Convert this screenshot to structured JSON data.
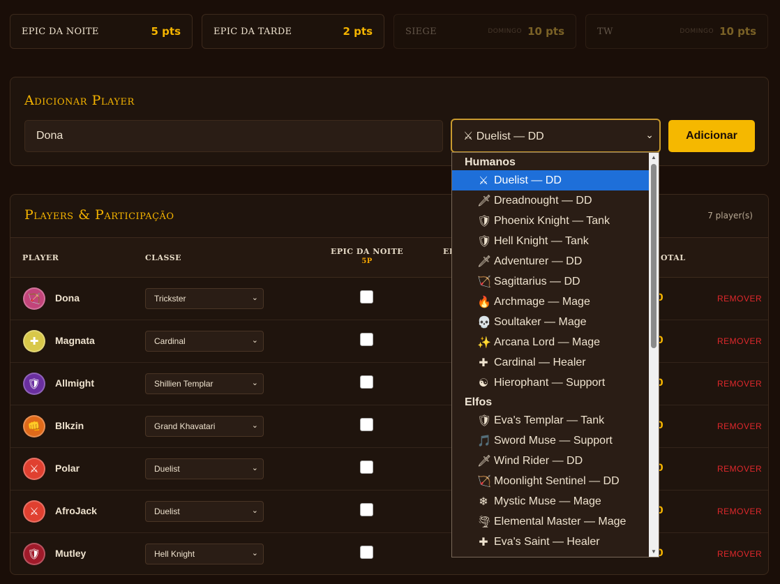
{
  "events": [
    {
      "name": "EPIC DA NOITE",
      "day": "",
      "pts": "5 pts",
      "dim": false
    },
    {
      "name": "EPIC DA TARDE",
      "day": "",
      "pts": "2 pts",
      "dim": false
    },
    {
      "name": "SIEGE",
      "day": "DOMINGO",
      "pts": "10 pts",
      "dim": true
    },
    {
      "name": "TW",
      "day": "DOMINGO",
      "pts": "10 pts",
      "dim": true
    }
  ],
  "add_panel": {
    "title": "Adicionar Player",
    "name_value": "Dona",
    "selected_class": "⚔ Duelist — DD",
    "add_label": "Adicionar"
  },
  "players_panel": {
    "title": "Players & Participação",
    "count": "7 player(s)",
    "headers": {
      "player": "PLAYER",
      "classe": "CLASSE",
      "epic_noite": "EPIC DA NOITE",
      "epic_noite_sub": "5P",
      "epic_tarde": "EF",
      "total": "OTAL"
    }
  },
  "players": [
    {
      "name": "Dona",
      "class": "Trickster",
      "icon": "🏹",
      "color": "#c2447a",
      "total": "0",
      "remove": "REMOVER"
    },
    {
      "name": "Magnata",
      "class": "Cardinal",
      "icon": "✚",
      "color": "#d8c84a",
      "total": "0",
      "remove": "REMOVER"
    },
    {
      "name": "Allmight",
      "class": "Shillien Templar",
      "icon": "🛡",
      "color": "#6a2fa0",
      "total": "0",
      "remove": "REMOVER"
    },
    {
      "name": "Blkzin",
      "class": "Grand Khavatari",
      "icon": "👊",
      "color": "#e06a1a",
      "total": "0",
      "remove": "REMOVER"
    },
    {
      "name": "Polar",
      "class": "Duelist",
      "icon": "⚔",
      "color": "#e04030",
      "total": "0",
      "remove": "REMOVER"
    },
    {
      "name": "AfroJack",
      "class": "Duelist",
      "icon": "⚔",
      "color": "#e04030",
      "total": "0",
      "remove": "REMOVER"
    },
    {
      "name": "Mutley",
      "class": "Hell Knight",
      "icon": "🛡",
      "color": "#a01a2a",
      "total": "0",
      "remove": "REMOVER"
    }
  ],
  "dropdown": {
    "groups": [
      {
        "label": "Humanos",
        "items": [
          {
            "icon": "⚔",
            "label": "Duelist — DD",
            "selected": true
          },
          {
            "icon": "🗡",
            "label": "Dreadnought — DD"
          },
          {
            "icon": "🛡",
            "label": "Phoenix Knight — Tank"
          },
          {
            "icon": "🛡",
            "label": "Hell Knight — Tank"
          },
          {
            "icon": "🗡",
            "label": "Adventurer — DD"
          },
          {
            "icon": "🏹",
            "label": "Sagittarius — DD"
          },
          {
            "icon": "🔥",
            "label": "Archmage — Mage"
          },
          {
            "icon": "💀",
            "label": "Soultaker — Mage"
          },
          {
            "icon": "✨",
            "label": "Arcana Lord — Mage"
          },
          {
            "icon": "✚",
            "label": "Cardinal — Healer"
          },
          {
            "icon": "☯",
            "label": "Hierophant — Support"
          }
        ]
      },
      {
        "label": "Elfos",
        "items": [
          {
            "icon": "🛡",
            "label": "Eva's Templar — Tank"
          },
          {
            "icon": "🎵",
            "label": "Sword Muse — Support"
          },
          {
            "icon": "🗡",
            "label": "Wind Rider — DD"
          },
          {
            "icon": "🏹",
            "label": "Moonlight Sentinel — DD"
          },
          {
            "icon": "❄",
            "label": "Mystic Muse — Mage"
          },
          {
            "icon": "🌪",
            "label": "Elemental Master — Mage"
          },
          {
            "icon": "✚",
            "label": "Eva's Saint — Healer"
          }
        ]
      }
    ]
  }
}
